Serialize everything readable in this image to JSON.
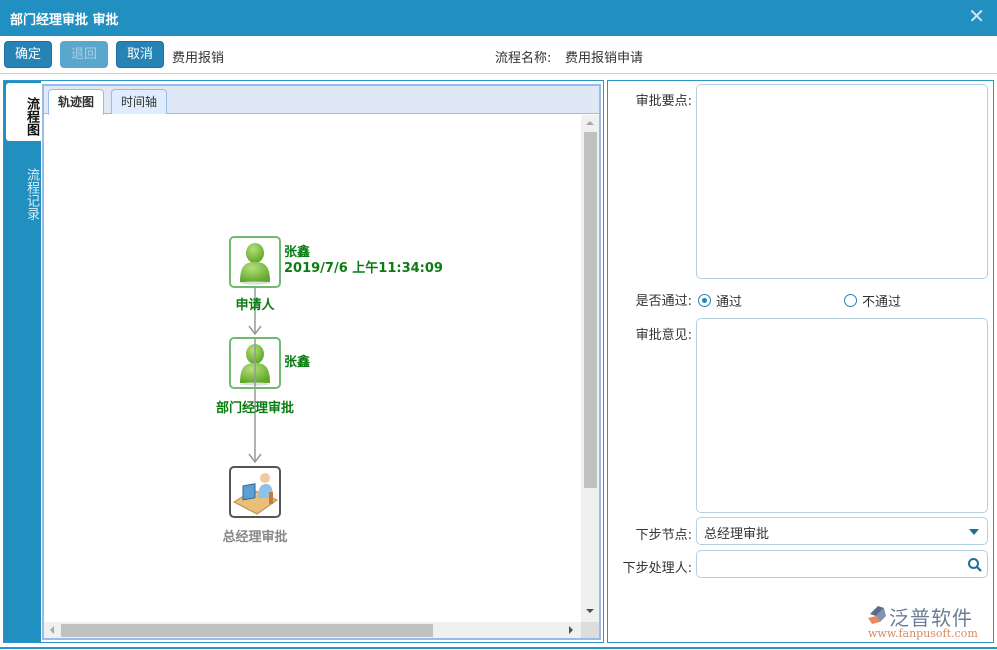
{
  "window": {
    "title": "部门经理审批 审批",
    "close_icon": "close-icon"
  },
  "toolbar": {
    "confirm_label": "确定",
    "return_label": "退回",
    "cancel_label": "取消",
    "form_type": "费用报销",
    "process_name_label": "流程名称:",
    "process_name_value": "费用报销申请"
  },
  "side_tabs": [
    {
      "label": "流程图",
      "active": true
    },
    {
      "label": "流程记录",
      "active": false
    }
  ],
  "view_tabs": [
    {
      "label": "轨迹图",
      "active": true
    },
    {
      "label": "时间轴",
      "active": false
    }
  ],
  "flow": {
    "nodes": [
      {
        "label": "申请人",
        "person": "张鑫",
        "time": "2019/7/6 上午11:34:09",
        "status": "done",
        "icon": "user-icon"
      },
      {
        "label": "部门经理审批",
        "person": "张鑫",
        "time": "",
        "status": "done",
        "icon": "user-icon"
      },
      {
        "label": "总经理审批",
        "person": "",
        "time": "",
        "status": "pending",
        "icon": "worker-at-desk-icon"
      }
    ]
  },
  "form": {
    "key_points_label": "审批要点:",
    "key_points_value": "",
    "pass_label": "是否通过:",
    "pass_options": [
      {
        "label": "通过",
        "checked": true
      },
      {
        "label": "不通过",
        "checked": false
      }
    ],
    "opinion_label": "审批意见:",
    "opinion_value": "",
    "next_node_label": "下步节点:",
    "next_node_value": "总经理审批",
    "next_handler_label": "下步处理人:",
    "next_handler_value": ""
  },
  "watermark": {
    "brand": "泛普软件",
    "url": "www.fanpusoft.com"
  },
  "colors": {
    "primary": "#2190c0",
    "done_green": "#0a7c12",
    "pending_grey": "#888888"
  }
}
